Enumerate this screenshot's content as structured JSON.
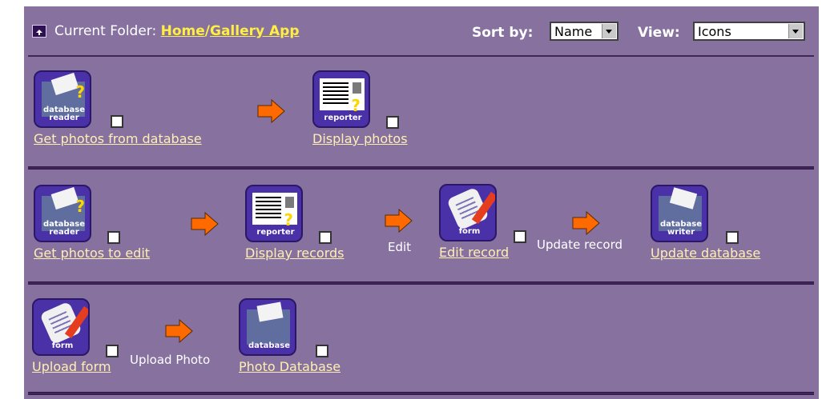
{
  "header": {
    "current_folder_label": "Current Folder:",
    "crumb_home": "Home",
    "crumb_sep": "/",
    "crumb_app": "Gallery App",
    "sort_label": "Sort by:",
    "sort_value": "Name",
    "view_label": "View:",
    "view_value": "Icons"
  },
  "rows": [
    {
      "nodes": [
        {
          "icon": "database-reader-icon",
          "icon_text": "database reader",
          "label": "Get photos from database"
        },
        {
          "icon": "reporter-icon",
          "icon_text": "reporter",
          "label": "Display photos"
        }
      ]
    },
    {
      "nodes": [
        {
          "icon": "database-reader-icon",
          "icon_text": "database reader",
          "label": "Get photos to edit"
        },
        {
          "icon": "reporter-icon",
          "icon_text": "reporter",
          "label": "Display records"
        },
        {
          "icon": "form-icon",
          "icon_text": "form",
          "label": "Edit record"
        },
        {
          "icon": "database-writer-icon",
          "icon_text": "database writer",
          "label": "Update database"
        }
      ],
      "connectors": [
        "Edit",
        "Update record"
      ]
    },
    {
      "nodes": [
        {
          "icon": "form-icon",
          "icon_text": "form",
          "label": "Upload form"
        },
        {
          "icon": "database-icon",
          "icon_text": "database",
          "label": "Photo Database"
        }
      ],
      "connectors": [
        "Upload Photo"
      ]
    }
  ],
  "colors": {
    "panel": "#86719f",
    "accent": "#ffef45",
    "arrow": "#ff6a00",
    "icon_bg": "#4b31a8"
  }
}
